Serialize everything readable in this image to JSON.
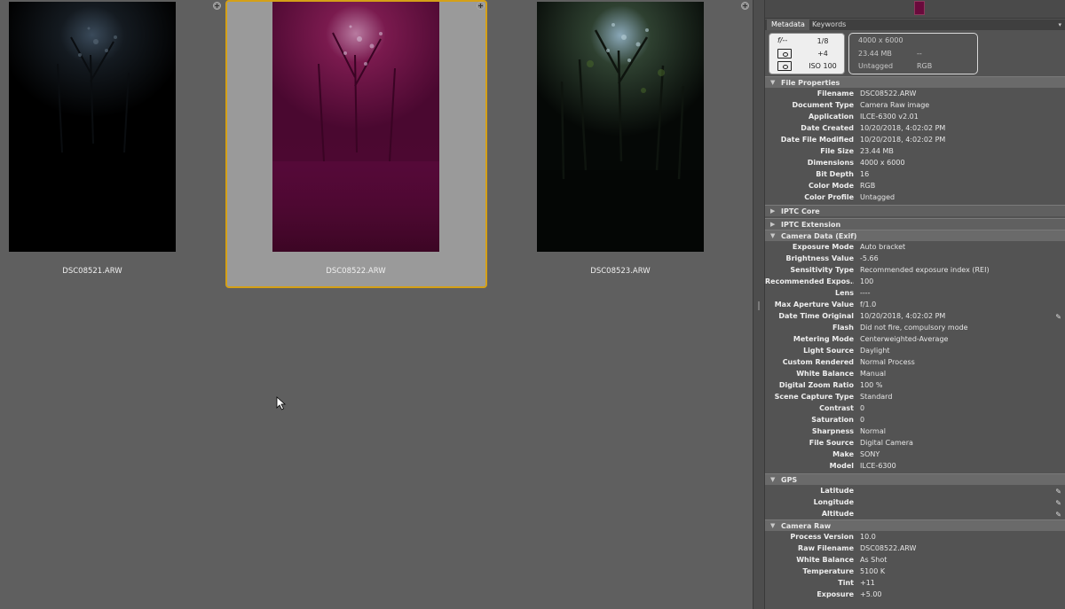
{
  "grid": {
    "items": [
      {
        "filename": "DSC08521.ARW"
      },
      {
        "filename": "DSC08522.ARW"
      },
      {
        "filename": "DSC08523.ARW"
      }
    ]
  },
  "panel": {
    "tabs": [
      "Metadata",
      "Keywords"
    ],
    "placard": {
      "aperture_icon": "f/--",
      "shutter": "1/8",
      "exposure_comp": "+4",
      "iso": "ISO 100",
      "dimensions": "4000 x 6000",
      "size": "23.44 MB",
      "dash": "--",
      "profile": "Untagged",
      "mode": "RGB"
    },
    "sections": {
      "file_properties": {
        "title": "File Properties",
        "rows": [
          {
            "k": "Filename",
            "v": "DSC08522.ARW"
          },
          {
            "k": "Document Type",
            "v": "Camera Raw image"
          },
          {
            "k": "Application",
            "v": "ILCE-6300 v2.01"
          },
          {
            "k": "Date Created",
            "v": "10/20/2018, 4:02:02 PM"
          },
          {
            "k": "Date File Modified",
            "v": "10/20/2018, 4:02:02 PM"
          },
          {
            "k": "File Size",
            "v": "23.44 MB"
          },
          {
            "k": "Dimensions",
            "v": "4000 x 6000"
          },
          {
            "k": "Bit Depth",
            "v": "16"
          },
          {
            "k": "Color Mode",
            "v": "RGB"
          },
          {
            "k": "Color Profile",
            "v": "Untagged"
          }
        ]
      },
      "iptc_core": {
        "title": "IPTC Core"
      },
      "iptc_extension": {
        "title": "IPTC Extension"
      },
      "camera_data": {
        "title": "Camera Data (Exif)",
        "rows": [
          {
            "k": "Exposure Mode",
            "v": "Auto bracket"
          },
          {
            "k": "Brightness Value",
            "v": "-5.66"
          },
          {
            "k": "Sensitivity Type",
            "v": "Recommended exposure index (REI)"
          },
          {
            "k": "Recommended Expos...",
            "v": "100"
          },
          {
            "k": "Lens",
            "v": "----"
          },
          {
            "k": "Max Aperture Value",
            "v": "f/1.0"
          },
          {
            "k": "Date Time Original",
            "v": "10/20/2018, 4:02:02 PM"
          },
          {
            "k": "Flash",
            "v": "Did not fire, compulsory mode"
          },
          {
            "k": "Metering Mode",
            "v": "Centerweighted-Average"
          },
          {
            "k": "Light Source",
            "v": "Daylight"
          },
          {
            "k": "Custom Rendered",
            "v": "Normal Process"
          },
          {
            "k": "White Balance",
            "v": "Manual"
          },
          {
            "k": "Digital Zoom Ratio",
            "v": "100 %"
          },
          {
            "k": "Scene Capture Type",
            "v": "Standard"
          },
          {
            "k": "Contrast",
            "v": "0"
          },
          {
            "k": "Saturation",
            "v": "0"
          },
          {
            "k": "Sharpness",
            "v": "Normal"
          },
          {
            "k": "File Source",
            "v": "Digital Camera"
          },
          {
            "k": "Make",
            "v": "SONY"
          },
          {
            "k": "Model",
            "v": "ILCE-6300"
          }
        ]
      },
      "gps": {
        "title": "GPS",
        "rows": [
          {
            "k": "Latitude",
            "v": ""
          },
          {
            "k": "Longitude",
            "v": ""
          },
          {
            "k": "Altitude",
            "v": ""
          }
        ]
      },
      "camera_raw": {
        "title": "Camera Raw",
        "rows": [
          {
            "k": "Process Version",
            "v": "10.0"
          },
          {
            "k": "Raw Filename",
            "v": "DSC08522.ARW"
          },
          {
            "k": "White Balance",
            "v": "As Shot"
          },
          {
            "k": "Temperature",
            "v": "5100 K"
          },
          {
            "k": "Tint",
            "v": "+11"
          },
          {
            "k": "Exposure",
            "v": "+5.00"
          }
        ]
      }
    }
  },
  "colors": {
    "selection_border": "#d4a017",
    "selected_cell_bg": "#9a9a9a",
    "content_bg": "#5f5f5f",
    "panel_bg": "#535353",
    "preview_tint": "#6a0a3c"
  }
}
